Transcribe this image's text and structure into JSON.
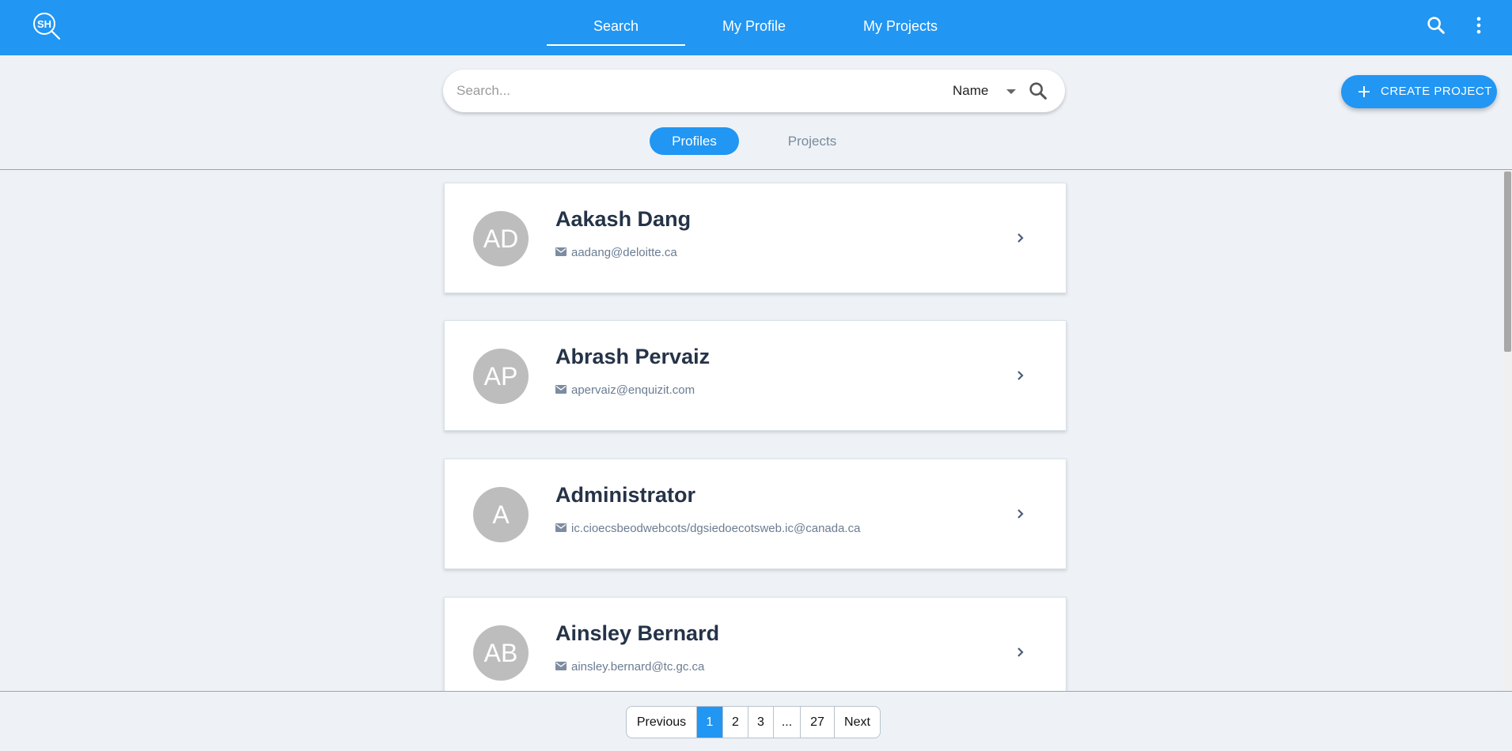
{
  "header": {
    "logo_text": "SH",
    "nav_tabs": [
      "Search",
      "My Profile",
      "My Projects"
    ],
    "active_tab": "Search",
    "icons": [
      "search-icon",
      "more-vertical-icon"
    ],
    "brand_color": "#2196f3"
  },
  "search": {
    "placeholder": "Search...",
    "value": "",
    "field_select": "Name"
  },
  "create_button": {
    "label": "CREATE PROJECT"
  },
  "toggle": {
    "options": [
      "Profiles",
      "Projects"
    ],
    "active": "Profiles"
  },
  "profiles": [
    {
      "initials": "AD",
      "name": "Aakash Dang",
      "email": "aadang@deloitte.ca"
    },
    {
      "initials": "AP",
      "name": "Abrash Pervaiz",
      "email": "apervaiz@enquizit.com"
    },
    {
      "initials": "A",
      "name": "Administrator",
      "email": "ic.cioecsbeodwebcots/dgsiedoecotsweb.ic@canada.ca"
    },
    {
      "initials": "AB",
      "name": "Ainsley Bernard",
      "email": "ainsley.bernard@tc.gc.ca"
    }
  ],
  "pagination": {
    "previous_label": "Previous",
    "pages": [
      "1",
      "2",
      "3",
      "...",
      "27"
    ],
    "current": "1",
    "next_label": "Next"
  }
}
